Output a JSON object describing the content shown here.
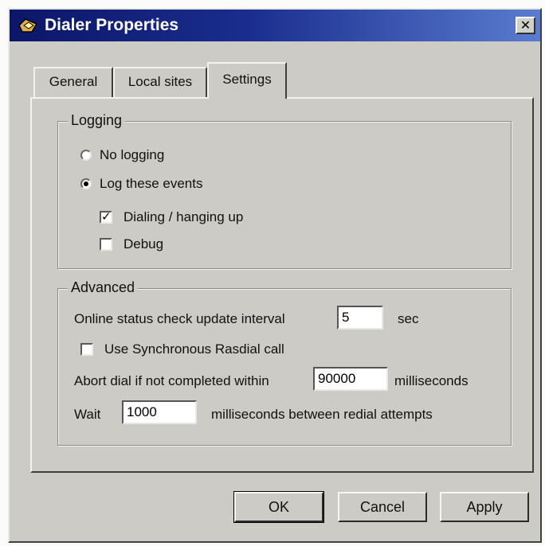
{
  "window": {
    "title": "Dialer Properties",
    "close_glyph": "✕"
  },
  "tabs": [
    {
      "label": "General",
      "active": false
    },
    {
      "label": "Local sites",
      "active": false
    },
    {
      "label": "Settings",
      "active": true
    }
  ],
  "logging": {
    "legend": "Logging",
    "options": [
      {
        "label": "No logging",
        "selected": false
      },
      {
        "label": "Log these events",
        "selected": true
      }
    ],
    "events": [
      {
        "label": "Dialing / hanging up",
        "checked": true
      },
      {
        "label": "Debug",
        "checked": false
      }
    ]
  },
  "advanced": {
    "legend": "Advanced",
    "online_status_label": "Online status check update interval",
    "online_status_value": "5",
    "online_status_unit": "sec",
    "sync_rasdial_label": "Use Synchronous Rasdial call",
    "sync_rasdial_checked": false,
    "abort_label": "Abort dial if not completed within",
    "abort_value": "90000",
    "abort_unit": "milliseconds",
    "wait_label": "Wait",
    "wait_value": "1000",
    "wait_suffix": "milliseconds between redial attempts"
  },
  "buttons": {
    "ok": "OK",
    "cancel": "Cancel",
    "apply": "Apply"
  },
  "colors": {
    "titlebar_start": "#0c1669",
    "titlebar_end": "#5a7cd0",
    "face": "#cccbc5"
  },
  "icons": {
    "title": "dialer-app-icon",
    "radio_checked": "●",
    "check_mark": "✓"
  }
}
